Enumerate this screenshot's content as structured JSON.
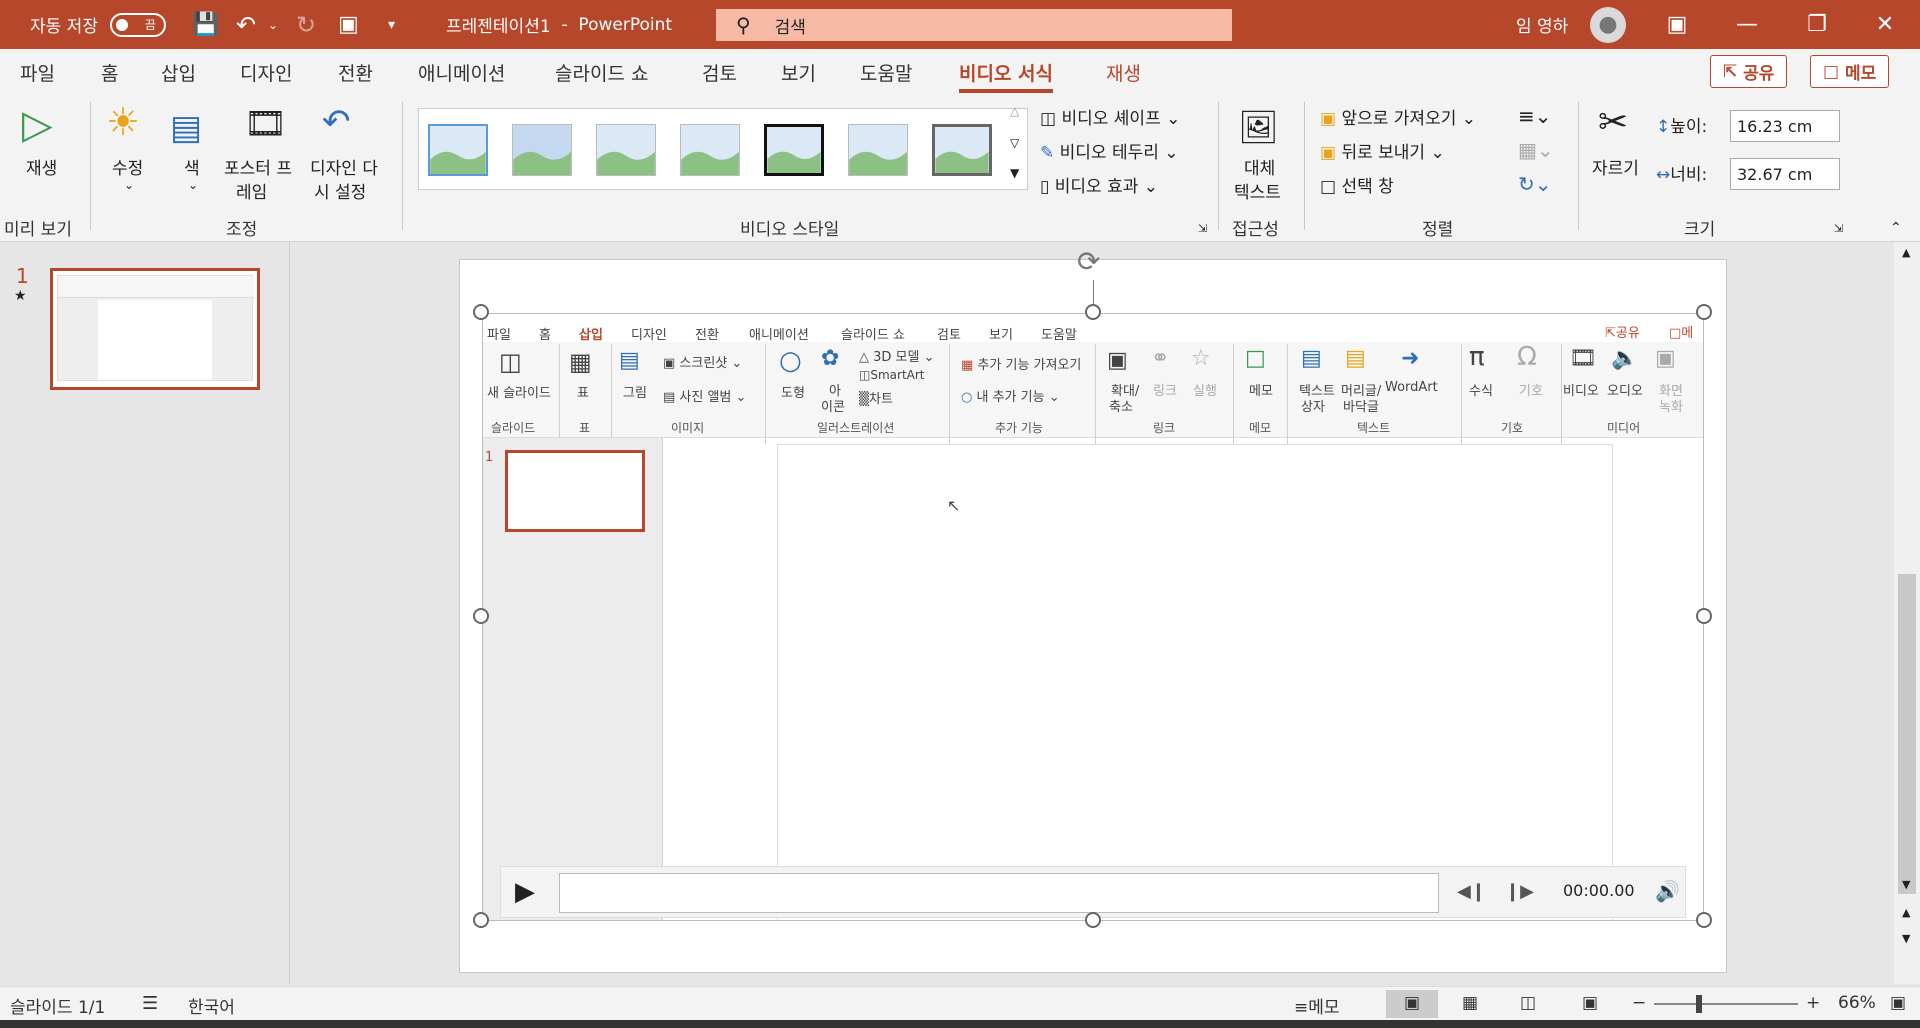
{
  "titlebar": {
    "autosave_label": "자동 저장",
    "autosave_state": "끔",
    "doc_title": "프레젠테이션1",
    "separator": "-",
    "app_name": "PowerPoint",
    "search_placeholder": "검색",
    "user_name": "임 영하"
  },
  "tabs": [
    "파일",
    "홈",
    "삽입",
    "디자인",
    "전환",
    "애니메이션",
    "슬라이드 쇼",
    "검토",
    "보기",
    "도움말",
    "비디오 서식",
    "재생"
  ],
  "share_label": "공유",
  "comment_label": "메모",
  "ribbon": {
    "play": "재생",
    "preview_group": "미리 보기",
    "corrections": "수정",
    "color": "색",
    "poster_frame_1": "포스터 프",
    "poster_frame_2": "레임",
    "reset_design_1": "디자인 다",
    "reset_design_2": "시 설정",
    "adjust_group": "조정",
    "video_styles_group": "비디오 스타일",
    "video_shape": "비디오 셰이프",
    "video_border": "비디오 테두리",
    "video_effects": "비디오 효과",
    "alt_text_1": "대체",
    "alt_text_2": "텍스트",
    "accessibility_group": "접근성",
    "bring_forward": "앞으로 가져오기",
    "send_backward": "뒤로 보내기",
    "selection_pane": "선택 창",
    "arrange_group": "정렬",
    "crop": "자르기",
    "height_label": "높이:",
    "height_value": "16.23 cm",
    "width_label": "너비:",
    "width_value": "32.67 cm",
    "size_group": "크기"
  },
  "slide_number": "1",
  "video": {
    "tabs": [
      "파일",
      "홈",
      "삽입",
      "디자인",
      "전환",
      "애니메이션",
      "슬라이드 쇼",
      "검토",
      "보기",
      "도움말"
    ],
    "share": "공유",
    "memo": "메",
    "new_slide": "새 슬라이드",
    "table": "표",
    "pictures": "그림",
    "screenshot": "스크린샷",
    "photo_album": "사진 앨범",
    "shapes": "도형",
    "icons_1": "아",
    "icons_2": "이콘",
    "models_3d": "3D 모델",
    "smartart": "SmartArt",
    "chart": "차트",
    "get_addins": "추가 기능 가져오기",
    "my_addins": "내 추가 기능",
    "zoom_1": "확대/",
    "zoom_2": "축소",
    "link": "링크",
    "action": "실행",
    "comment": "메모",
    "textbox_1": "텍스트",
    "textbox_2": "상자",
    "header_1": "머리글/",
    "header_2": "바닥글",
    "wordart": "WordArt",
    "equation": "수식",
    "symbol": "기호",
    "video_btn": "비디오",
    "audio_btn": "오디오",
    "screen_rec_1": "화면",
    "screen_rec_2": "녹화",
    "groups": [
      "슬라이드",
      "표",
      "이미지",
      "일러스트레이션",
      "추가 기능",
      "링크",
      "메모",
      "텍스트",
      "기호",
      "미디어"
    ],
    "thumb_number": "1",
    "time": "00:00.00"
  },
  "status": {
    "slide_info": "슬라이드 1/1",
    "language": "한국어",
    "notes": "메모",
    "zoom": "66%"
  },
  "colors": {
    "accent": "#b7472a",
    "search_bg": "#f6b9a5"
  }
}
